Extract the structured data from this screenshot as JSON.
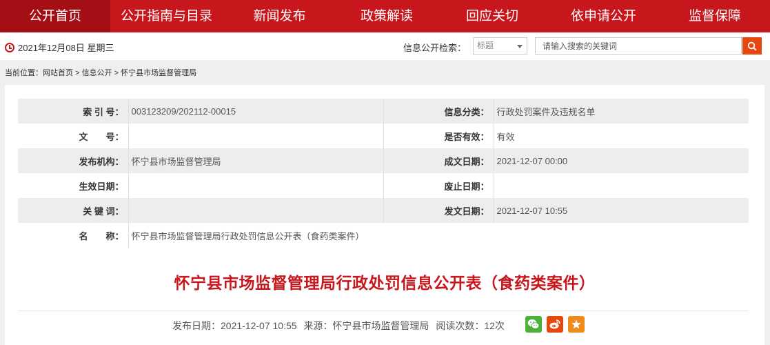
{
  "nav": [
    "公开首页",
    "公开指南与目录",
    "新闻发布",
    "政策解读",
    "回应关切",
    "依申请公开",
    "监督保障"
  ],
  "date": "2021年12月08日 星期三",
  "search": {
    "label": "信息公开检索：",
    "select_value": "标题",
    "placeholder": "请输入搜索的关键词"
  },
  "breadcrumb": {
    "prefix": "当前位置：",
    "items": [
      "网站首页",
      "信息公开",
      "怀宁县市场监督管理局"
    ],
    "sep": ">"
  },
  "meta": {
    "index_label": "索 引 号：",
    "index_value": "003123209/202112-00015",
    "category_label": "信息分类：",
    "category_value": "行政处罚案件及违规名单",
    "docno_label": "文　　号：",
    "docno_value": "",
    "valid_label": "是否有效：",
    "valid_value": "有效",
    "publisher_label": "发布机构：",
    "publisher_value": "怀宁县市场监督管理局",
    "created_label": "成文日期：",
    "created_value": "2021-12-07 00:00",
    "effective_label": "生效日期：",
    "effective_value": "",
    "expired_label": "废止日期：",
    "expired_value": "",
    "keywords_label": "关 键 词：",
    "keywords_value": "",
    "issued_label": "发文日期：",
    "issued_value": "2021-12-07 10:55",
    "name_label": "名　　称：",
    "name_value": "怀宁县市场监督管理局行政处罚信息公开表（食药类案件）"
  },
  "article": {
    "title": "怀宁县市场监督管理局行政处罚信息公开表（食药类案件）",
    "publish_date": "发布日期：2021-12-07 10:55",
    "source": "来源：怀宁县市场监督管理局",
    "views": "阅读次数：12次"
  },
  "colors": {
    "brand": "#c8161d",
    "accent": "#e6470f"
  }
}
